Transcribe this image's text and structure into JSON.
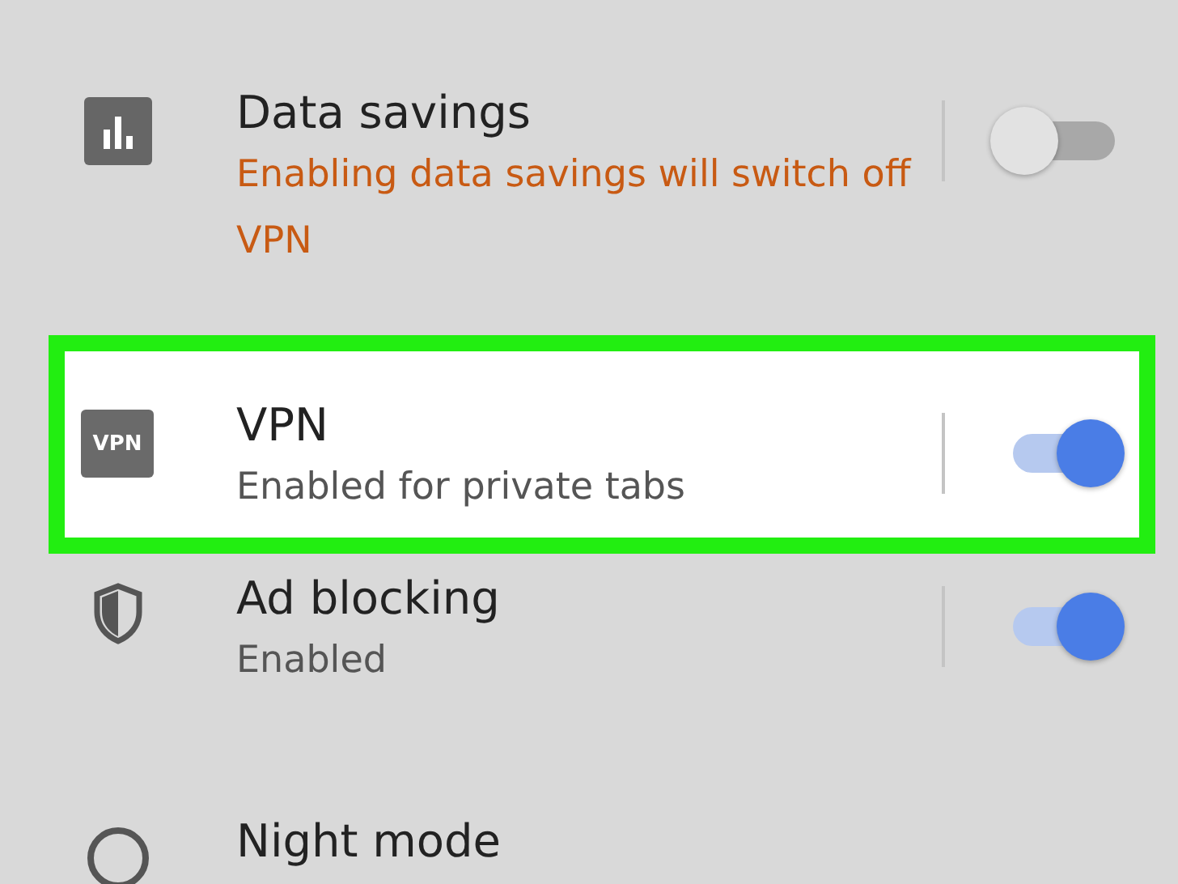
{
  "settings": [
    {
      "kind": "chart",
      "title": "Data savings",
      "subtitle": "Enabling data savings will switch off VPN",
      "warning": true,
      "highlighted": false,
      "on": false
    },
    {
      "kind": "vpn",
      "icon_text": "VPN",
      "title": "VPN",
      "subtitle": "Enabled for private tabs",
      "warning": false,
      "highlighted": true,
      "on": true
    },
    {
      "kind": "shield",
      "title": "Ad blocking",
      "subtitle": "Enabled",
      "warning": false,
      "highlighted": false,
      "on": true
    },
    {
      "kind": "moon",
      "title": "Night mode",
      "highlighted": false
    }
  ]
}
